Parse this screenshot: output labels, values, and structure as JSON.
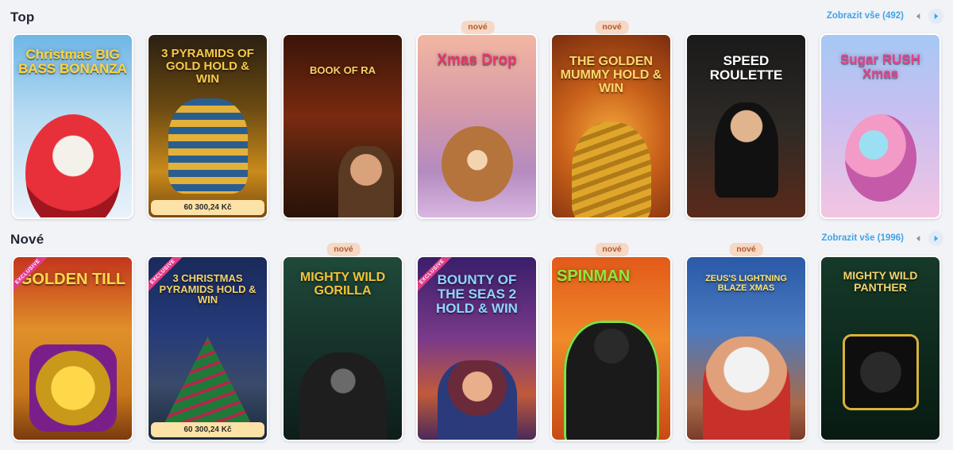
{
  "sections": {
    "top": {
      "title": "Top",
      "show_all": "Zobrazit vše (492)",
      "games": [
        {
          "title": "Christmas BIG BASS BONANZA",
          "new": false,
          "jackpot": ""
        },
        {
          "title": "3 PYRAMIDS OF GOLD HOLD & WIN",
          "new": false,
          "jackpot": "60 300,24 Kč"
        },
        {
          "title": "BOOK OF RA",
          "new": false,
          "jackpot": ""
        },
        {
          "title": "Xmas Drop",
          "new": true,
          "jackpot": ""
        },
        {
          "title": "THE GOLDEN MUMMY HOLD & WIN",
          "new": true,
          "jackpot": ""
        },
        {
          "title": "SPEED ROULETTE",
          "new": false,
          "jackpot": ""
        },
        {
          "title": "Sugar RUSH Xmas",
          "new": false,
          "jackpot": ""
        }
      ]
    },
    "new": {
      "title": "Nové",
      "show_all": "Zobrazit vše (1996)",
      "games": [
        {
          "title": "GOLDEN TILL",
          "new": false,
          "exclusive": true,
          "jackpot": ""
        },
        {
          "title": "3 CHRISTMAS PYRAMIDS HOLD & WIN",
          "new": false,
          "exclusive": true,
          "jackpot": "60 300,24 Kč"
        },
        {
          "title": "MIGHTY WILD GORILLA",
          "new": true,
          "exclusive": false,
          "jackpot": ""
        },
        {
          "title": "BOUNTY OF THE SEAS 2 HOLD & WIN",
          "new": false,
          "exclusive": true,
          "jackpot": ""
        },
        {
          "title": "SPINMAN",
          "new": true,
          "exclusive": false,
          "jackpot": ""
        },
        {
          "title": "ZEUS'S LIGHTNING BLAZE XMAS",
          "new": true,
          "exclusive": false,
          "jackpot": ""
        },
        {
          "title": "MIGHTY WILD PANTHER",
          "new": false,
          "exclusive": false,
          "jackpot": ""
        }
      ]
    }
  },
  "labels": {
    "new_badge": "nové",
    "exclusive": "EXCLUSIVE"
  },
  "colors": {
    "accent": "#3fa3e8",
    "badge_bg": "#f6d8c6",
    "jackpot_bg": "#fde2a7"
  }
}
